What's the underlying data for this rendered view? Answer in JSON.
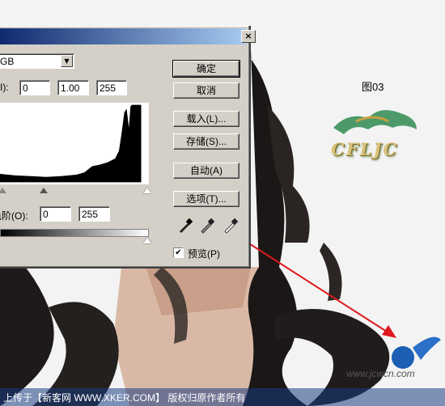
{
  "dialog": {
    "channel_value": "GB",
    "input_levels_label": "I):",
    "input_black": "0",
    "input_gamma": "1.00",
    "input_white": "255",
    "output_levels_label": "色阶(O):",
    "output_black": "0",
    "output_white": "255",
    "close_glyph": "×",
    "buttons": {
      "ok": "确定",
      "cancel": "取消",
      "load": "载入(L)...",
      "save": "存储(S)...",
      "auto": "自动(A)",
      "options": "选项(T)..."
    },
    "preview_label": "预览(P)",
    "preview_checked": true,
    "check_glyph": "✔"
  },
  "figure_label": "图03",
  "logo_text": "CFLJC",
  "footer_text": "上传于【新客网 WWW.XKER.COM】 版权归原作者所有",
  "watermark_text": "www.jcwcn.com",
  "colors": {
    "dialog_bg": "#d4d0c8",
    "title_start": "#0a246a",
    "annotation_red": "#e0181c",
    "footer_bg": "#3c5a96"
  }
}
